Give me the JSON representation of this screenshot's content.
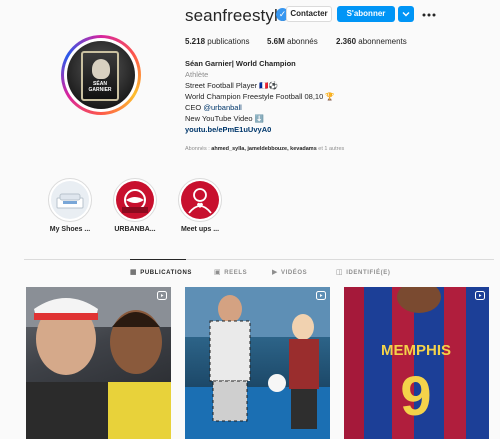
{
  "profile": {
    "username": "seanfreestyle",
    "avatar_card": {
      "line1": "SÉAN",
      "line2": "GARNIER"
    }
  },
  "actions": {
    "contact_label": "Contacter",
    "follow_label": "S'abonner",
    "dropdown_icon": "chevron-down-icon",
    "more_icon": "more-horizontal-icon"
  },
  "stats": {
    "posts_count": "5.218",
    "posts_label": "publications",
    "followers_count": "5.6M",
    "followers_label": "abonnés",
    "following_count": "2.360",
    "following_label": "abonnements"
  },
  "bio": {
    "name": "Séan Garnier| World Champion",
    "category": "Athlète",
    "line1": "Street Football Player 🇫🇷⚽",
    "line2": "World Champion Freestyle Football 08,10 🏆",
    "line3_prefix": "CEO ",
    "line3_mention": "@urbanball",
    "line4": "New YouTube Video ⬇️",
    "link": "youtu.be/ePmE1uUvyA0"
  },
  "followed_by": {
    "prefix": "Abonnés : ",
    "names": "ahmed_sylla, jameldebbouze, kevadams",
    "suffix": " et 1 autres"
  },
  "highlights": [
    {
      "label": "My Shoes ..."
    },
    {
      "label": "URBANBA..."
    },
    {
      "label": "Meet ups ..."
    }
  ],
  "tabs": [
    {
      "label": "PUBLICATIONS",
      "icon": "grid-icon",
      "active": true
    },
    {
      "label": "REELS",
      "icon": "reels-icon",
      "active": false
    },
    {
      "label": "VIDÉOS",
      "icon": "video-icon",
      "active": false
    },
    {
      "label": "IDENTIFIÉ(E)",
      "icon": "tag-icon",
      "active": false
    }
  ],
  "posts": [
    {
      "type": "reel",
      "type_icon": "reels-icon"
    },
    {
      "type": "reel",
      "type_icon": "reels-icon"
    },
    {
      "type": "reel",
      "type_icon": "reels-icon"
    }
  ],
  "colors": {
    "accent": "#0095f6",
    "verified": "#3897f0",
    "link": "#00376b",
    "muted": "#8e8e8e"
  }
}
